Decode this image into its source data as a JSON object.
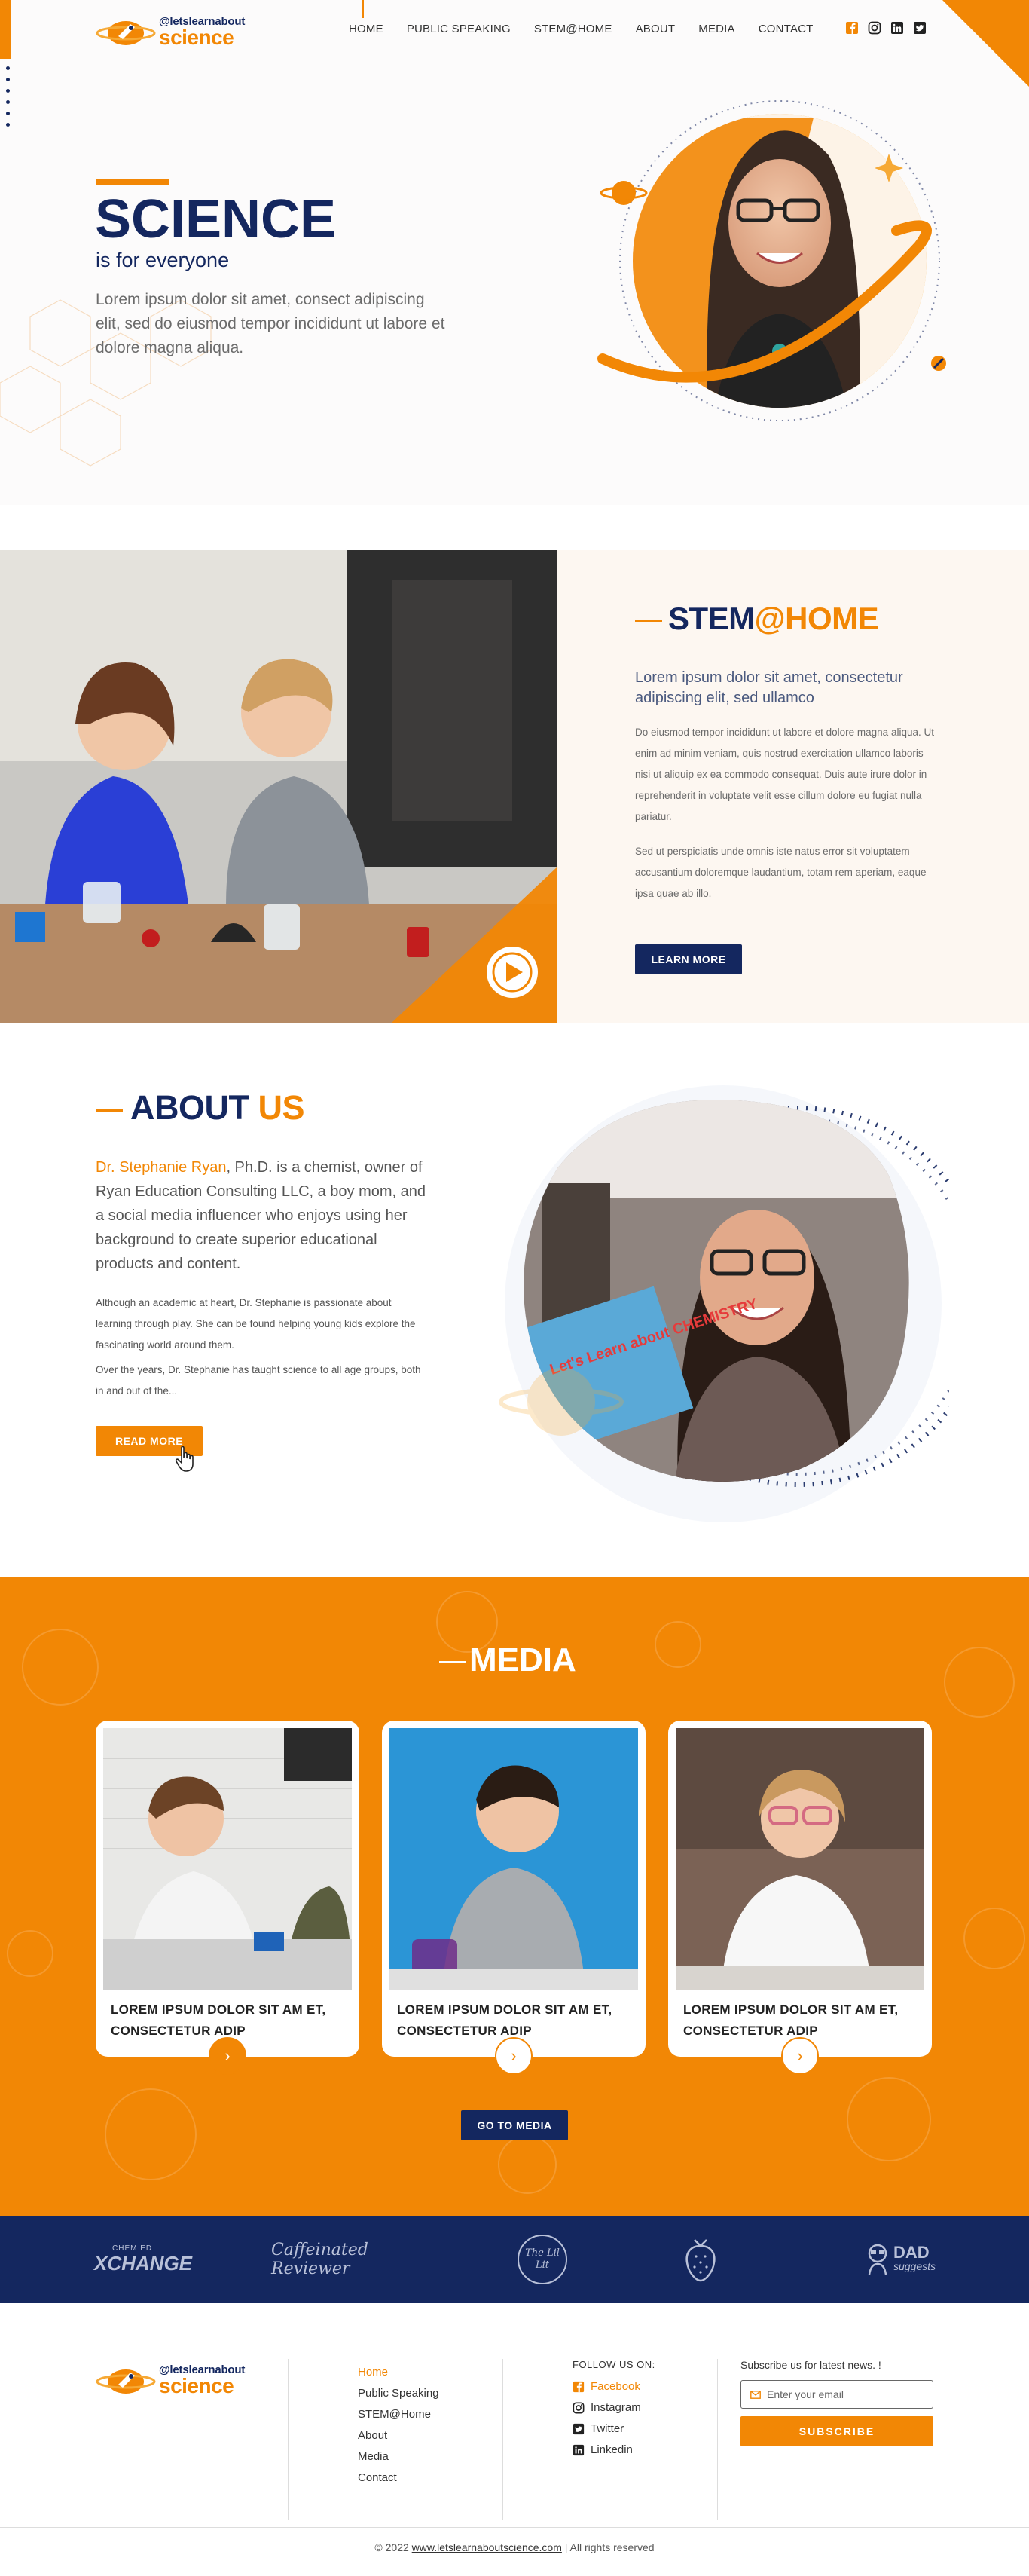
{
  "brand": {
    "logo_top": "@letslearnabout",
    "logo_bottom": "science"
  },
  "nav": {
    "items": [
      "HOME",
      "PUBLIC SPEAKING",
      "STEM@HOME",
      "ABOUT",
      "MEDIA",
      "CONTACT"
    ]
  },
  "socials": [
    "facebook-icon",
    "instagram-icon",
    "linkedin-icon",
    "twitter-icon"
  ],
  "colors": {
    "accent": "#f28705",
    "navy": "#14275f"
  },
  "hero": {
    "title": "SCIENCE",
    "subtitle": "is for everyone",
    "description": "Lorem ipsum dolor sit amet, consect adipiscing elit, sed do eiusmod tempor incididunt ut labore et dolore magna aliqua."
  },
  "stem": {
    "heading_prefix": "STEM",
    "heading_accent": "@HOME",
    "lead": "Lorem ipsum dolor sit amet, consectetur adipiscing elit, sed ullamco",
    "p1": "Do eiusmod tempor incididunt ut labore et dolore magna aliqua. Ut enim ad minim veniam, quis nostrud exercitation ullamco laboris nisi ut aliquip ex ea commodo consequat. Duis aute irure dolor in reprehenderit in voluptate velit esse cillum dolore eu fugiat nulla pariatur.",
    "p2": "Sed ut perspiciatis unde omnis iste natus error sit voluptatem accusantium doloremque laudantium, totam rem aperiam, eaque ipsa quae ab illo.",
    "button": "LEARN MORE"
  },
  "about": {
    "heading_prefix": "ABOUT",
    "heading_accent": "US",
    "lead_name": "Dr. Stephanie Ryan",
    "lead_rest": ", Ph.D. is a chemist, owner of Ryan Education Consulting LLC, a boy mom, and a social media influencer who enjoys using her background to create superior educational products and content.",
    "p1": "Although an academic at heart, Dr. Stephanie is passionate about learning through play. She can be found helping young kids explore the fascinating world around them.",
    "p2": "Over the years, Dr. Stephanie has taught science to all age groups, both in and out of the...",
    "button": "READ  MORE",
    "book_text": "Let's Learn about CHEMISTRY"
  },
  "media": {
    "heading": "MEDIA",
    "cards": [
      {
        "title": "LOREM IPSUM DOLOR SIT AM ET, CONSECTETUR ADIP"
      },
      {
        "title": "LOREM IPSUM DOLOR SIT AM ET, CONSECTETUR ADIP"
      },
      {
        "title": "LOREM IPSUM DOLOR SIT AM ET, CONSECTETUR ADIP"
      }
    ],
    "button": "GO TO MEDIA"
  },
  "partners": {
    "xchange_small": "CHEM ED",
    "xchange_main": "XCHANGE",
    "caffeinated": "Caffeinated Reviewer",
    "lil": "The Lil Lit",
    "dad_main": "DAD",
    "dad_sub": "suggests"
  },
  "footer": {
    "links": [
      "Home",
      "Public Speaking",
      "STEM@Home",
      "About",
      "Media",
      "Contact"
    ],
    "follow_label": "FOLLOW US ON:",
    "follow": [
      "Facebook",
      "Instagram",
      "Twitter",
      "Linkedin"
    ],
    "subscribe_label": "Subscribe us for latest news. !",
    "email_placeholder": "Enter your email",
    "subscribe_button": "SUBSCRIBE",
    "copyright_pre": "© 2022",
    "copyright_url": "www.letslearnaboutscience.com",
    "copyright_post": "| All rights reserved"
  }
}
